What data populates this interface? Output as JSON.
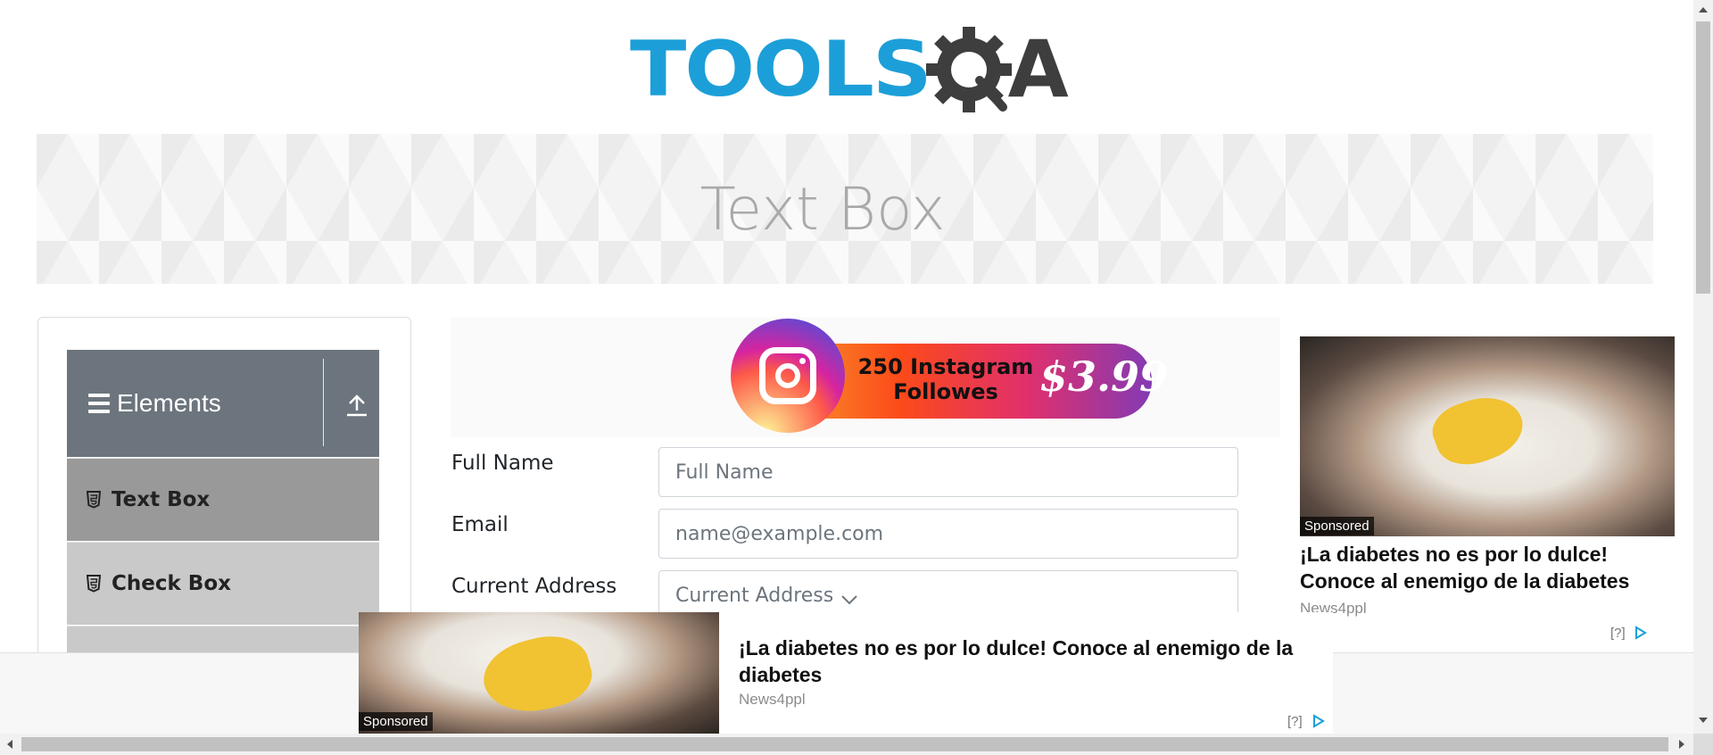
{
  "logo": {
    "tools": "TOOLS",
    "q_icon": "gear-magnifier-icon",
    "a": "A"
  },
  "banner": {
    "title": "Text Box"
  },
  "sidebar": {
    "group_title": "Elements",
    "items": [
      {
        "label": "Text Box",
        "active": true
      },
      {
        "label": "Check Box",
        "active": false
      }
    ]
  },
  "top_ad": {
    "line1": "250 Instagram",
    "line2": "Followes",
    "price": "$3.99"
  },
  "form": {
    "full_name": {
      "label": "Full Name",
      "placeholder": "Full Name"
    },
    "email": {
      "label": "Email",
      "placeholder": "name@example.com"
    },
    "current_address": {
      "label": "Current Address",
      "placeholder": "Current Address"
    }
  },
  "right_ad": {
    "sponsored": "Sponsored",
    "headline": "¡La diabetes no es por lo dulce! Conoce al enemigo de la diabetes",
    "source": "News4ppl",
    "help": "[?]"
  },
  "bottom_ad": {
    "sponsored": "Sponsored",
    "headline": "¡La diabetes no es por lo dulce! Conoce al enemigo de la diabetes",
    "source": "News4ppl",
    "help": "[?]"
  },
  "colors": {
    "brand_blue": "#1c9fd8",
    "brand_dark": "#3e3e3e",
    "sidebar_header": "#6c757d",
    "sidebar_active": "#999999",
    "sidebar_item": "#c9c9c9"
  }
}
